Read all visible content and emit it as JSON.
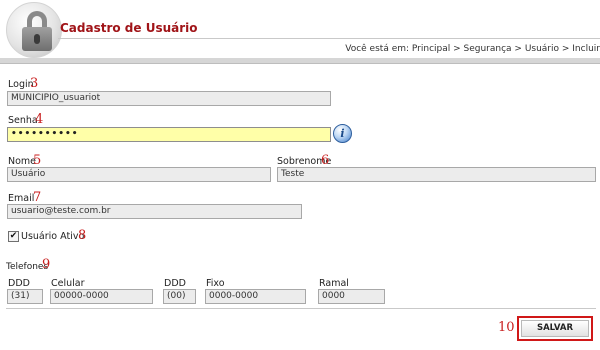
{
  "header": {
    "title": "Cadastro de Usuário",
    "breadcrumb": "Você está em: Principal > Segurança > Usuário > Incluir",
    "logo_icon": "lock-icon"
  },
  "form": {
    "login": {
      "label": "Login",
      "value": "MUNICIPIO_usuariot",
      "marker": "3"
    },
    "senha": {
      "label": "Senha",
      "value": "••••••••••",
      "marker": "4",
      "info_icon": "info-icon",
      "info_glyph": "i"
    },
    "nome": {
      "label": "Nome",
      "value": "Usuário",
      "marker": "5"
    },
    "sobrenome": {
      "label": "Sobrenome",
      "value": "Teste",
      "marker": "6"
    },
    "email": {
      "label": "Email",
      "value": "usuario@teste.com.br",
      "marker": "7"
    },
    "ativo": {
      "label": "Usuário Ativo",
      "checked": true,
      "check_glyph": "✔",
      "marker": "8"
    },
    "telefones": {
      "label": "Telefones",
      "marker": "9",
      "ddd1_label": "DDD",
      "ddd1_value": "(31)",
      "celular_label": "Celular",
      "celular_value": "00000-0000",
      "ddd2_label": "DDD",
      "ddd2_value": "(00)",
      "fixo_label": "Fixo",
      "fixo_value": "0000-0000",
      "ramal_label": "Ramal",
      "ramal_value": "0000"
    }
  },
  "actions": {
    "save_label": "SALVAR",
    "marker": "10"
  },
  "colors": {
    "title": "#a01418",
    "marker": "#c81e1e",
    "password_bg": "#ffffa8",
    "button_border": "#d01818"
  }
}
